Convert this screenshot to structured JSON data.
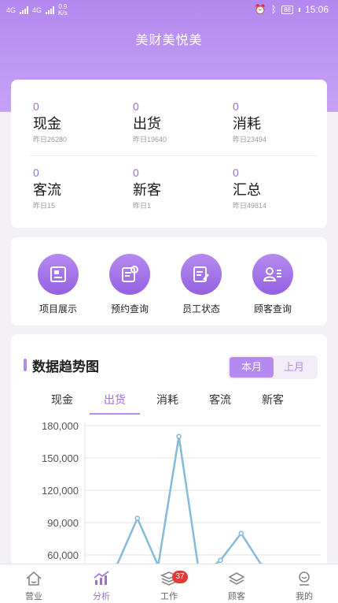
{
  "status_bar": {
    "net_left": "4G",
    "net_right": "4G",
    "speed_value": "0.9",
    "speed_unit": "K/s",
    "battery": "88",
    "time": "15:06"
  },
  "app_title": "美财美悦美",
  "stats": [
    {
      "value": "0",
      "name": "现金",
      "yesterday": "昨日26280"
    },
    {
      "value": "0",
      "name": "出货",
      "yesterday": "昨日19640"
    },
    {
      "value": "0",
      "name": "消耗",
      "yesterday": "昨日23494"
    },
    {
      "value": "0",
      "name": "客流",
      "yesterday": "昨日15"
    },
    {
      "value": "0",
      "name": "新客",
      "yesterday": "昨日1"
    },
    {
      "value": "0",
      "name": "汇总",
      "yesterday": "昨日49814"
    }
  ],
  "actions": [
    {
      "label": "项目展示",
      "icon": "project-icon"
    },
    {
      "label": "预约查询",
      "icon": "appointment-search-icon"
    },
    {
      "label": "员工状态",
      "icon": "staff-status-icon"
    },
    {
      "label": "顾客查询",
      "icon": "customer-search-icon"
    }
  ],
  "chart_section": {
    "title": "数据趋势图",
    "toggle": {
      "this_month": "本月",
      "last_month": "上月"
    },
    "tabs": [
      "现金",
      "出货",
      "消耗",
      "客流",
      "新客"
    ],
    "active_tab": "出货"
  },
  "chart_data": {
    "type": "line",
    "title": "",
    "xlabel": "",
    "ylabel": "",
    "ylim": [
      60000,
      180000
    ],
    "y_ticks": [
      "180,000",
      "150,000",
      "120,000",
      "90,000",
      "60,000"
    ],
    "y_tick_values": [
      180000,
      150000,
      120000,
      90000,
      60000
    ],
    "series": [
      {
        "values": [
          40000,
          50000,
          94000,
          50000,
          170000,
          40000,
          55000,
          80000,
          50000
        ]
      }
    ],
    "grid": true,
    "line_color": "#86b9dc"
  },
  "tabbar": {
    "items": [
      {
        "label": "营业",
        "icon": "home-icon"
      },
      {
        "label": "分析",
        "icon": "analysis-icon"
      },
      {
        "label": "工作",
        "icon": "work-icon",
        "badge": "37"
      },
      {
        "label": "顾客",
        "icon": "customer-icon"
      },
      {
        "label": "我的",
        "icon": "profile-icon"
      }
    ],
    "active_index": 1
  }
}
